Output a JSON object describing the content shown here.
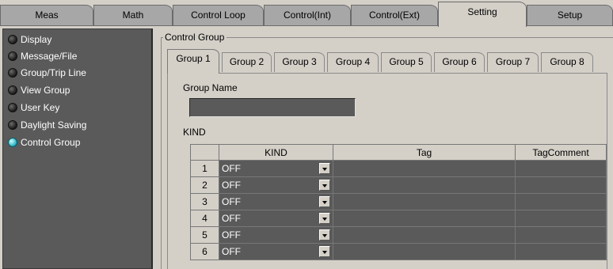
{
  "top_tabs": [
    {
      "label": "Meas"
    },
    {
      "label": "Math"
    },
    {
      "label": "Control Loop"
    },
    {
      "label": "Control(Int)"
    },
    {
      "label": "Control(Ext)"
    },
    {
      "label": "Setting"
    },
    {
      "label": "Setup"
    }
  ],
  "active_top_tab": "Setting",
  "sidebar": {
    "items": [
      {
        "label": "Display",
        "selected": false
      },
      {
        "label": "Message/File",
        "selected": false
      },
      {
        "label": "Group/Trip Line",
        "selected": false
      },
      {
        "label": "View Group",
        "selected": false
      },
      {
        "label": "User Key",
        "selected": false
      },
      {
        "label": "Daylight Saving",
        "selected": false
      },
      {
        "label": "Control Group",
        "selected": true
      }
    ]
  },
  "main": {
    "frame_title": "Control Group",
    "group_tabs": [
      {
        "label": "Group 1"
      },
      {
        "label": "Group 2"
      },
      {
        "label": "Group 3"
      },
      {
        "label": "Group 4"
      },
      {
        "label": "Group 5"
      },
      {
        "label": "Group 6"
      },
      {
        "label": "Group 7"
      },
      {
        "label": "Group 8"
      }
    ],
    "active_group_tab": "Group 1",
    "group_name_label": "Group Name",
    "group_name_value": "",
    "kind_label": "KIND",
    "table": {
      "headers": {
        "kind": "KIND",
        "tag": "Tag",
        "tag_comment": "TagComment"
      },
      "rows": [
        {
          "num": "1",
          "kind": "OFF",
          "tag": "",
          "tag_comment": ""
        },
        {
          "num": "2",
          "kind": "OFF",
          "tag": "",
          "tag_comment": ""
        },
        {
          "num": "3",
          "kind": "OFF",
          "tag": "",
          "tag_comment": ""
        },
        {
          "num": "4",
          "kind": "OFF",
          "tag": "",
          "tag_comment": ""
        },
        {
          "num": "5",
          "kind": "OFF",
          "tag": "",
          "tag_comment": ""
        },
        {
          "num": "6",
          "kind": "OFF",
          "tag": "",
          "tag_comment": ""
        }
      ]
    }
  },
  "colors": {
    "panel_bg": "#d4d0c8",
    "sidebar_bg": "#5a5a5a",
    "selected_indicator": "#2fb4c4"
  }
}
